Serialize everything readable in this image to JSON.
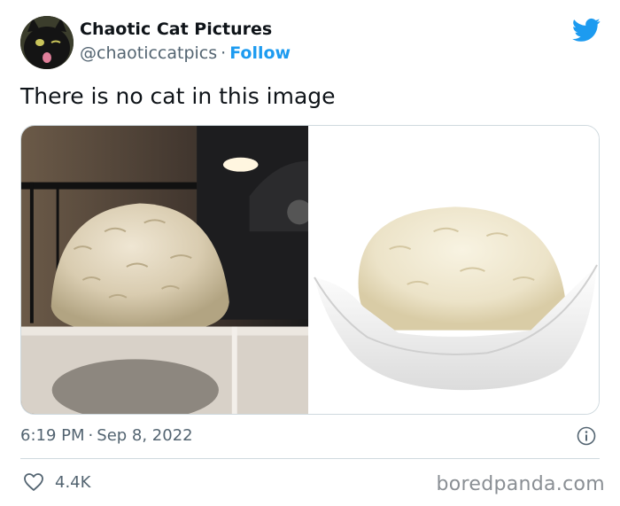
{
  "author": {
    "name": "Chaotic Cat Pictures",
    "handle": "@chaoticcatpics",
    "separator": "·",
    "follow_label": "Follow"
  },
  "icons": {
    "brand": "twitter-bird-icon",
    "info": "info-icon",
    "like": "heart-icon",
    "brand_color": "#1d9bf0"
  },
  "tweet": {
    "text": "There is no cat in this image"
  },
  "media": {
    "images": [
      {
        "name": "fluffy-cat-back-photo"
      },
      {
        "name": "ice-cream-scoop-photo"
      }
    ]
  },
  "meta": {
    "time": "6:19 PM",
    "separator": "·",
    "date": "Sep 8, 2022"
  },
  "engagement": {
    "likes": "4.4K"
  },
  "watermark": {
    "text": "boredpanda.com"
  }
}
